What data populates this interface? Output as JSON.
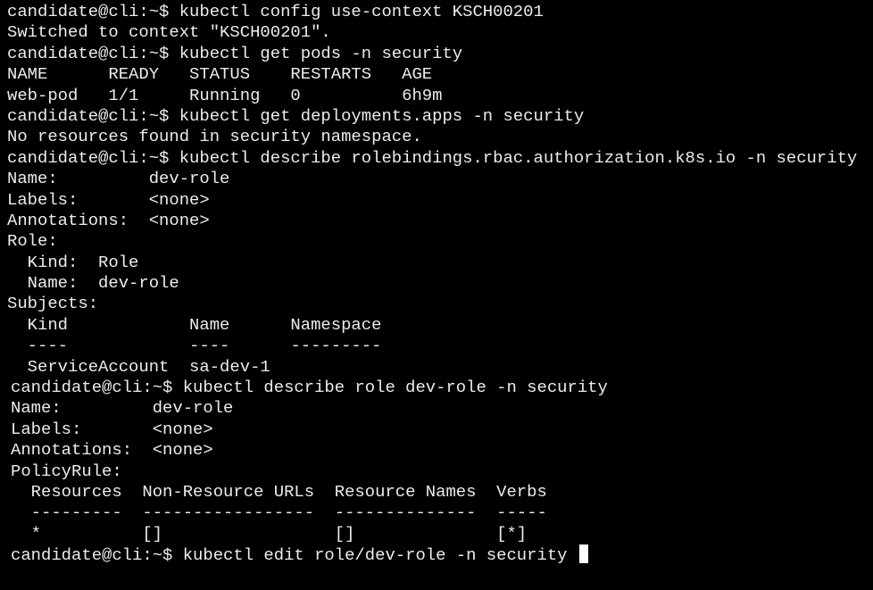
{
  "terminal": {
    "lines": [
      "candidate@cli:~$ kubectl config use-context KSCH00201",
      "Switched to context \"KSCH00201\".",
      "candidate@cli:~$ kubectl get pods -n security",
      "NAME      READY   STATUS    RESTARTS   AGE",
      "web-pod   1/1     Running   0          6h9m",
      "candidate@cli:~$ kubectl get deployments.apps -n security",
      "No resources found in security namespace.",
      "candidate@cli:~$ kubectl describe rolebindings.rbac.authorization.k8s.io -n security",
      "Name:         dev-role",
      "Labels:       <none>",
      "Annotations:  <none>",
      "Role:",
      "  Kind:  Role",
      "  Name:  dev-role",
      "Subjects:",
      "  Kind            Name      Namespace",
      "  ----            ----      ---------",
      "  ServiceAccount  sa-dev-1",
      "candidate@cli:~$ kubectl describe role dev-role -n security",
      "Name:         dev-role",
      "Labels:       <none>",
      "Annotations:  <none>",
      "PolicyRule:",
      "  Resources  Non-Resource URLs  Resource Names  Verbs",
      "  ---------  -----------------  --------------  -----",
      "  *          []                 []              [*]",
      "candidate@cli:~$ kubectl edit role/dev-role -n security "
    ]
  },
  "colors": {
    "background": "#000000",
    "foreground": "#ececec",
    "cursor": "#ffffff"
  }
}
